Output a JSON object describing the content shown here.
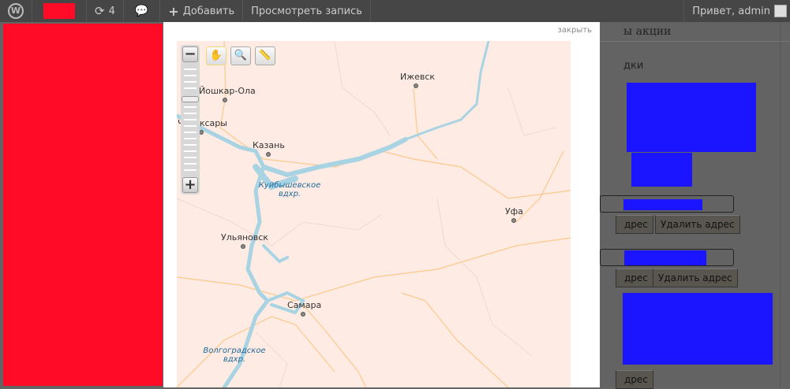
{
  "adminbar": {
    "updates_count": "4",
    "add_label": "Добавить",
    "view_label": "Просмотреть запись",
    "greeting": "Привет, admin"
  },
  "background": {
    "heading": "ы акции",
    "label": "дки",
    "buttons": [
      "дрес",
      "Удалить адрес",
      "дрес",
      "Удалить адрес",
      "дрес"
    ]
  },
  "modal": {
    "close_label": "закрыть"
  },
  "map": {
    "cities": [
      "Ижевск",
      "Йошкар-Ола",
      "Чебоксары",
      "Казань",
      "Уфа",
      "Ульяновск",
      "Самара"
    ],
    "water": [
      "Куйбышевское вдхр.",
      "Волгоградское вдхр."
    ]
  },
  "colors": {
    "redact_red": "#ff0a27",
    "redact_blue": "#1a14ff",
    "map_bg": "#feebe3",
    "water": "#a8d3e3"
  }
}
